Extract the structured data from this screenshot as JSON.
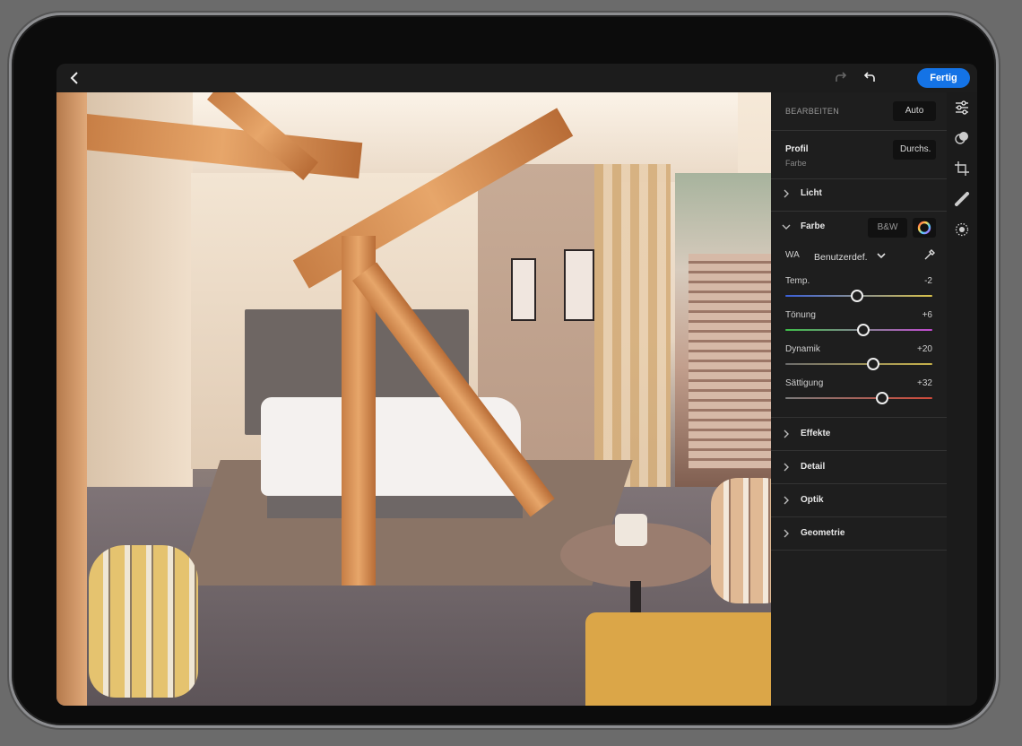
{
  "topbar": {
    "done_label": "Fertig"
  },
  "panel": {
    "section_title": "BEARBEITEN",
    "auto_label": "Auto",
    "profile": {
      "label": "Profil",
      "value": "Farbe",
      "browse_label": "Durchs."
    },
    "light_label": "Licht",
    "color": {
      "label": "Farbe",
      "bw_label": "B&W",
      "wb_label": "WA",
      "wb_value": "Benutzerdef.",
      "sliders": [
        {
          "label": "Temp.",
          "value": "-2",
          "position": 0.49
        },
        {
          "label": "Tönung",
          "value": "+6",
          "position": 0.53
        },
        {
          "label": "Dynamik",
          "value": "+20",
          "position": 0.6
        },
        {
          "label": "Sättigung",
          "value": "+32",
          "position": 0.66
        }
      ]
    },
    "effects_label": "Effekte",
    "detail_label": "Detail",
    "optics_label": "Optik",
    "geometry_label": "Geometrie"
  },
  "toolbar_icons": [
    "edit-sliders-icon",
    "presets-icon",
    "crop-icon",
    "healing-icon",
    "selective-icon"
  ],
  "colors": {
    "accent": "#1473e6",
    "panel_bg": "#1e1e1e"
  }
}
